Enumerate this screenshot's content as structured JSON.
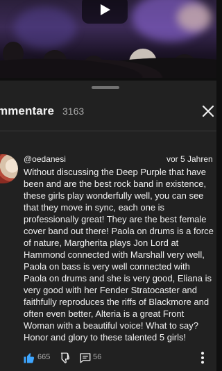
{
  "video": {
    "play_icon": "play-icon"
  },
  "comments_panel": {
    "title": "mmentare",
    "count": "3163",
    "close_icon": "close-icon"
  },
  "comment": {
    "author": "@oedanesi",
    "timestamp": "vor 5 Jahren",
    "text": "Without discussing the Deep Purple that have been and are the best rock band in existence, these girls play wonderfully well, you can see that they move in sync, each one is professionally great! They are the best female cover band out there! Paola on drums is a force of nature, Margherita plays Jon Lord at Hammond connected with Marshall very well, Paola on bass is very well connected with Paola on drums and she is very good, Eliana is very good with her Fender Stratocaster and faithfully reproduces the riffs of Blackmore and often even better, Alteria is a great Front Woman with a beautiful voice! What to say? Honor and glory to these talented 5 girls!",
    "likes": "665",
    "replies": "56",
    "like_icon": "thumbs-up-icon",
    "dislike_icon": "thumbs-down-icon",
    "reply_icon": "reply-bubble-icon",
    "more_icon": "more-vertical-icon"
  },
  "colors": {
    "background": "#0f0f0f",
    "sheet": "#212121",
    "like_active": "#3ea6ff",
    "text_secondary": "#aaaaaa"
  }
}
